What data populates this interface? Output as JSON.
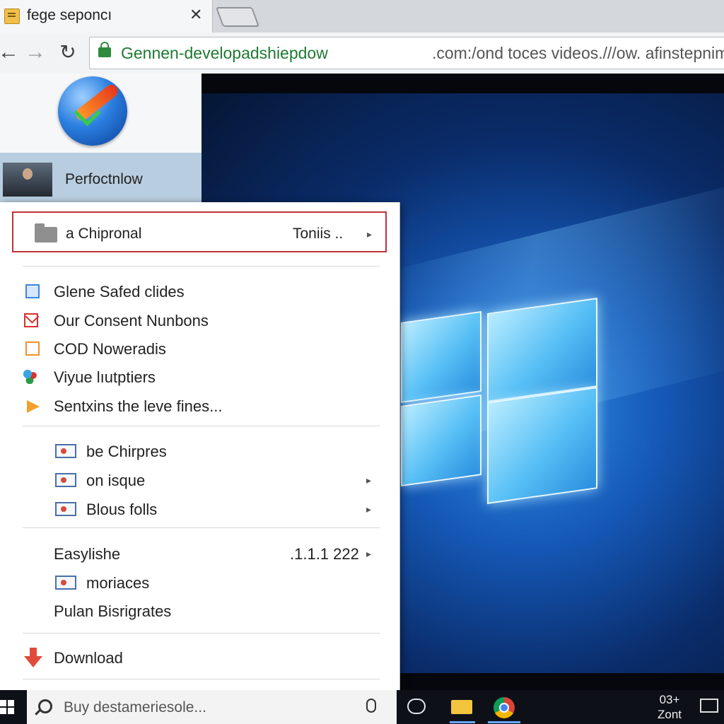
{
  "browser": {
    "tab_title": "fege seponcı",
    "tab_close": "✕",
    "url_domain": "Gennen-developadshiepdow",
    "url_path": ".com:/ond toces videos.///ow. afinstepnim"
  },
  "page": {
    "user_name": "Perfoctnlow"
  },
  "video": {
    "progress_fraction": 0.54
  },
  "context_menu": {
    "top_item": {
      "label": "a Chipronal",
      "accel": "Toniis .."
    },
    "group1": [
      {
        "label": "Glene Safed clides",
        "icon": "document-icon"
      },
      {
        "label": "Our Consent Nunbons",
        "icon": "mail-icon"
      },
      {
        "label": "COD Noweradis",
        "icon": "page-icon"
      },
      {
        "label": "Viyue lıutptiers",
        "icon": "people-icon"
      },
      {
        "label": "Sentxins the leve fines...",
        "icon": "play-icon"
      }
    ],
    "group2": [
      {
        "label": "be Chirpres",
        "icon": "image-icon",
        "submenu": false
      },
      {
        "label": "on isque",
        "icon": "image-icon",
        "submenu": true
      },
      {
        "label": "Blous folls",
        "icon": "image-icon",
        "submenu": true
      }
    ],
    "group3": [
      {
        "label": "Easylishe",
        "accel": ".1.1.1 222",
        "submenu": true
      },
      {
        "label": "moriaces",
        "icon": "image-icon"
      },
      {
        "label": "Pulan Bisrigrates"
      }
    ],
    "download_label": "Download"
  },
  "taskbar": {
    "search_placeholder": "Buy destameriesole...",
    "tray_time_line1": "03+",
    "tray_time_line2": "Zont"
  }
}
